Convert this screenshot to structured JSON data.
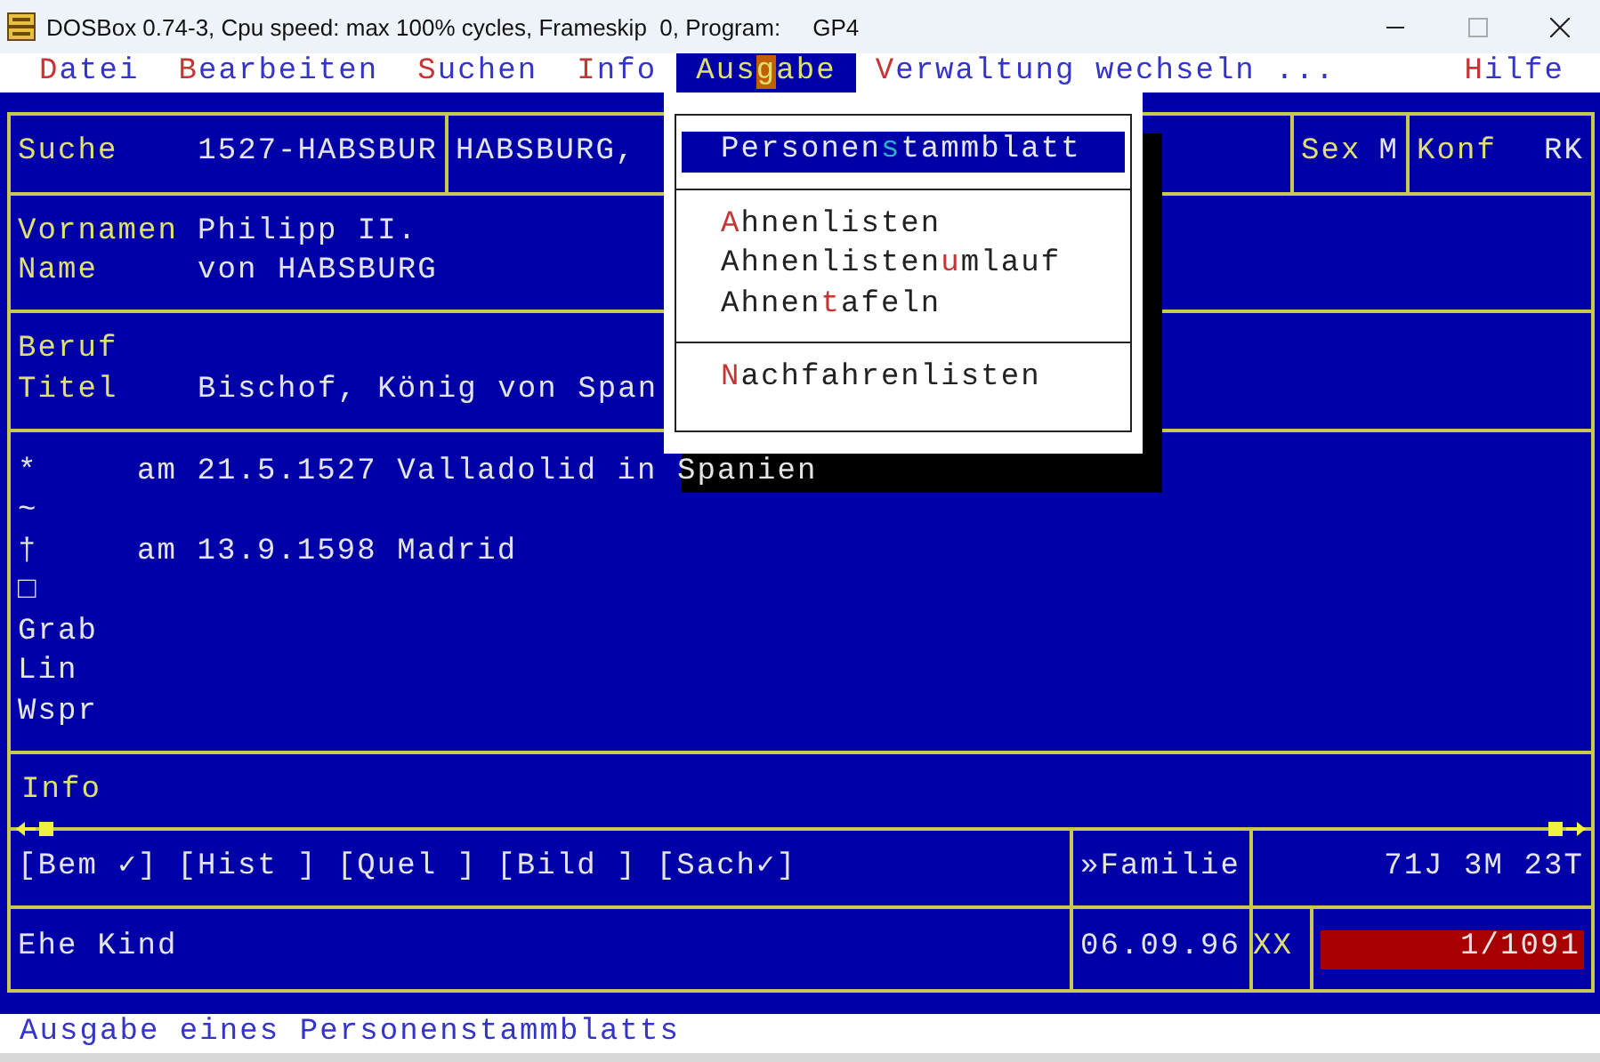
{
  "window": {
    "title": "DOSBox 0.74-3, Cpu speed: max 100% cycles, Frameskip  0, Program:     GP4"
  },
  "menu_bar": [
    {
      "key": "D",
      "after": "atei",
      "selected": false
    },
    {
      "key": "B",
      "after": "earbeiten",
      "selected": false
    },
    {
      "key": "S",
      "after": "uchen",
      "selected": false
    },
    {
      "key": "I",
      "after": "nfo",
      "selected": false
    },
    {
      "before": "Aus",
      "key": "g",
      "after": "abe",
      "selected": true
    },
    {
      "key": "V",
      "after": "erwaltung wechseln ...",
      "selected": false
    },
    {
      "key": "H",
      "after": "ilfe",
      "selected": false
    }
  ],
  "record": {
    "search_label": "Suche",
    "search_value": "1527-HABSBUR",
    "name_preview": "HABSBURG,",
    "sex_label": "Sex",
    "sex_value": "M",
    "konf_label": "Konf",
    "konf_value": "RK"
  },
  "names": [
    {
      "label": "Vornamen",
      "value": "Philipp II."
    },
    {
      "label": "Name",
      "value": "von HABSBURG"
    }
  ],
  "titles": [
    {
      "label": "Beruf"
    },
    {
      "label": "Titel",
      "value": "Bischof, König von Span"
    }
  ],
  "events": [
    {
      "label": "*",
      "value": "am 21.5.1527 Valladolid in Spanien"
    },
    {
      "label": "~"
    },
    {
      "label": "†",
      "value": "am 13.9.1598 Madrid"
    },
    {
      "label": "□"
    },
    {
      "label": "Grab"
    },
    {
      "label": "Lin"
    },
    {
      "label": "Wspr"
    }
  ],
  "info_label": "Info",
  "flags": [
    "[Bem ✓]",
    "[Hist ]",
    "[Quel ]",
    "[Bild ]",
    "[Sach✓]"
  ],
  "family_link": "»Familie",
  "age": "71J 3M 23T",
  "relations": [
    "Ehe",
    "Kind"
  ],
  "date": "06.09.96",
  "marker": "XX",
  "record_counter": "1/1091",
  "dropdown": {
    "groups": [
      [
        {
          "before": "Personen",
          "key": "s",
          "after": "tammblatt",
          "selected": true
        }
      ],
      [
        {
          "key": "A",
          "after": "hnenlisten",
          "selected": false
        },
        {
          "before": "Ahnenlisten",
          "key": "u",
          "after": "mlauf",
          "selected": false
        },
        {
          "before": "Ahnen",
          "key": "t",
          "after": "afeln",
          "selected": false
        }
      ],
      [
        {
          "key": "N",
          "after": "achfahrenlisten",
          "selected": false
        }
      ]
    ]
  },
  "status_line": "Ausgabe eines Personenstammblatts"
}
